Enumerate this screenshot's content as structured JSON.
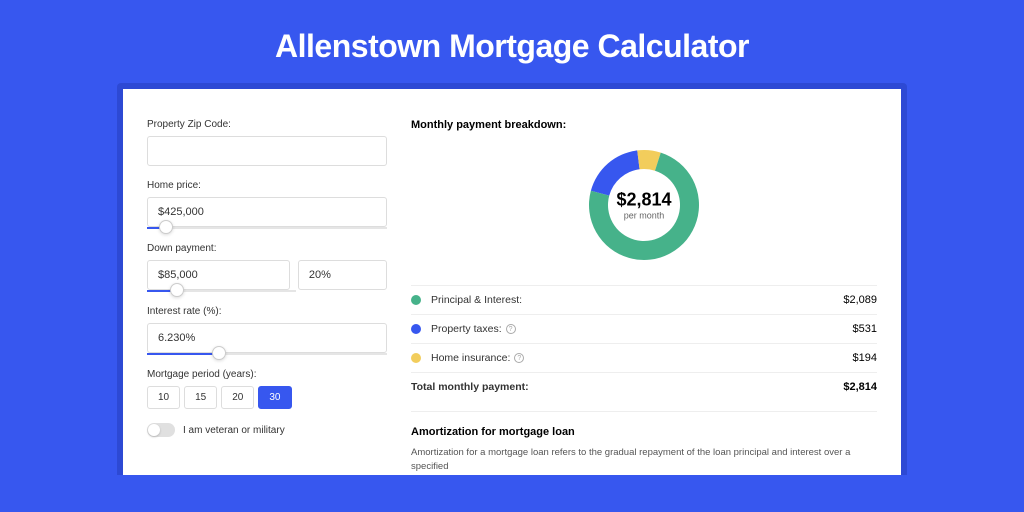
{
  "header": {
    "title": "Allenstown Mortgage Calculator"
  },
  "form": {
    "zip": {
      "label": "Property Zip Code:",
      "value": ""
    },
    "home_price": {
      "label": "Home price:",
      "value": "$425,000",
      "slider_pct": 8
    },
    "down_payment": {
      "label": "Down payment:",
      "value": "$85,000",
      "pct_value": "20%",
      "slider_pct": 20
    },
    "interest": {
      "label": "Interest rate (%):",
      "value": "6.230%",
      "slider_pct": 30
    },
    "period": {
      "label": "Mortgage period (years):",
      "options": [
        "10",
        "15",
        "20",
        "30"
      ],
      "active_index": 3
    },
    "veteran": {
      "label": "I am veteran or military",
      "on": false
    }
  },
  "breakdown": {
    "title": "Monthly payment breakdown:",
    "center_value": "$2,814",
    "center_sub": "per month",
    "items": [
      {
        "label": "Principal & Interest:",
        "value": "$2,089",
        "color": "#46b28a",
        "info": false
      },
      {
        "label": "Property taxes:",
        "value": "$531",
        "color": "#3757ef",
        "info": true
      },
      {
        "label": "Home insurance:",
        "value": "$194",
        "color": "#f2cd5c",
        "info": true
      }
    ],
    "total": {
      "label": "Total monthly payment:",
      "value": "$2,814"
    }
  },
  "chart_data": {
    "type": "pie",
    "title": "Monthly payment breakdown",
    "series": [
      {
        "name": "Principal & Interest",
        "value": 2089,
        "color": "#46b28a"
      },
      {
        "name": "Property taxes",
        "value": 531,
        "color": "#3757ef"
      },
      {
        "name": "Home insurance",
        "value": 194,
        "color": "#f2cd5c"
      }
    ],
    "total": 2814,
    "center_label": "$2,814 per month"
  },
  "amort": {
    "title": "Amortization for mortgage loan",
    "text": "Amortization for a mortgage loan refers to the gradual repayment of the loan principal and interest over a specified"
  }
}
